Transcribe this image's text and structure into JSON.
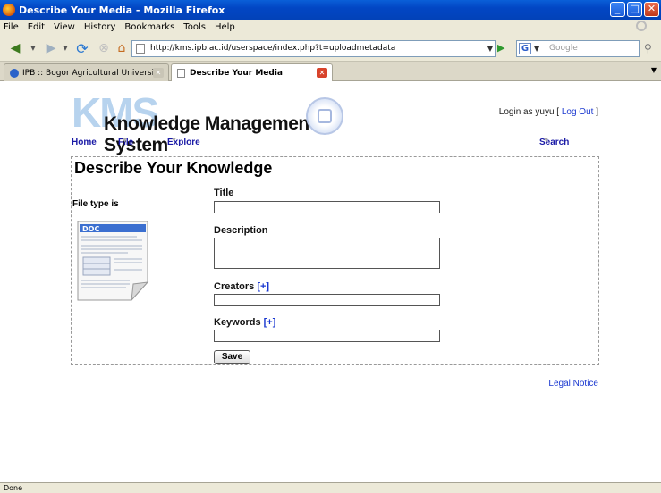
{
  "window": {
    "title": "Describe Your Media - Mozilla Firefox",
    "controls": {
      "minimize": "_",
      "maximize": "□",
      "close": "✕"
    }
  },
  "menu": {
    "items": [
      "File",
      "Edit",
      "View",
      "History",
      "Bookmarks",
      "Tools",
      "Help"
    ]
  },
  "toolbar": {
    "url": "http://kms.ipb.ac.id/userspace/index.php?t=uploadmetadata",
    "search_placeholder": "Google",
    "search_engine_glyph": "G"
  },
  "tabs": [
    {
      "label": "IPB :: Bogor Agricultural University",
      "active": false
    },
    {
      "label": "Describe Your Media",
      "active": true
    }
  ],
  "site": {
    "logo_abbr": "KMS",
    "logo_full": "Knowledge Management System",
    "login_prefix": "Login as yuyu [",
    "logout_label": "Log Out",
    "login_suffix": "]",
    "nav": {
      "home": "Home",
      "file": "File",
      "explore": "Explore",
      "search": "Search",
      "dropdown_glyph": "▼"
    }
  },
  "form": {
    "heading": "Describe Your Knowledge",
    "file_type_label": "File type is",
    "doc_icon_label": "DOC",
    "title_label": "Title",
    "title_value": "",
    "description_label": "Description",
    "description_value": "",
    "creators_label": "Creators",
    "creators_value": "",
    "keywords_label": "Keywords",
    "keywords_value": "",
    "add_more": "[+]",
    "save_label": "Save"
  },
  "footer": {
    "legal": "Legal Notice"
  },
  "status": {
    "text": "Done"
  }
}
